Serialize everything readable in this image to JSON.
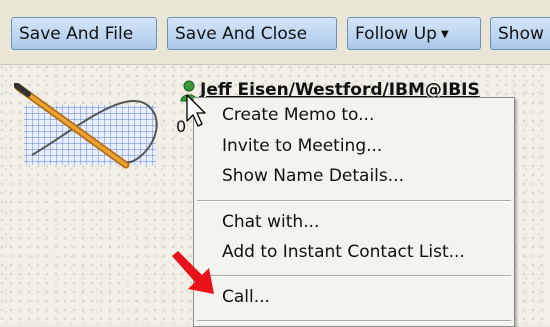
{
  "toolbar": {
    "buttons": [
      {
        "label": "Save And File"
      },
      {
        "label": "Save And Close"
      },
      {
        "label": "Follow Up",
        "dropdown": true
      },
      {
        "label": "Show"
      }
    ]
  },
  "message": {
    "sender_name": "Jeff Eisen/Westford/IBM@IBIS",
    "sender_icon": "person-icon",
    "count_text": "0"
  },
  "context_menu": {
    "items": [
      {
        "label": "Create Memo to..."
      },
      {
        "label": "Invite to Meeting..."
      },
      {
        "label": "Show Name Details..."
      },
      {
        "label": "Chat with..."
      },
      {
        "label": "Add to Instant Contact List..."
      },
      {
        "label": "Call..."
      }
    ]
  },
  "colors": {
    "button_border": "#6d8fb9",
    "button_fill": "#aac8ea",
    "annotation_arrow": "#e8121a"
  }
}
